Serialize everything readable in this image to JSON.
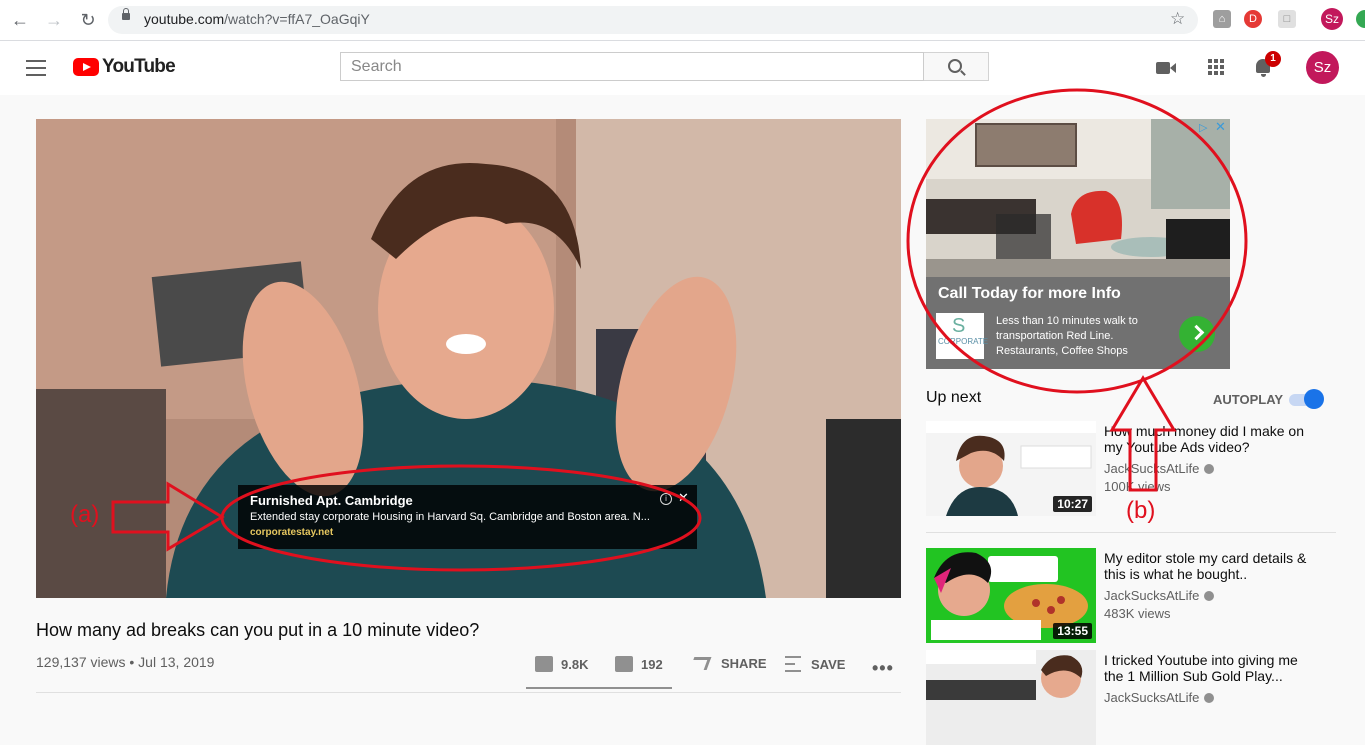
{
  "browser": {
    "url_host": "youtube.com",
    "url_path": "/watch?v=ffA7_OaGqiY",
    "profile_initials": "Sz"
  },
  "header": {
    "logo_text": "YouTube",
    "search_placeholder": "Search",
    "notification_count": "1",
    "avatar_initials": "Sz"
  },
  "video": {
    "title": "How many ad breaks can you put in a 10 minute video?",
    "meta": "129,137 views • Jul 13, 2019",
    "likes": "9.8K",
    "dislikes": "192",
    "share_label": "SHARE",
    "save_label": "SAVE",
    "more_label": "•••"
  },
  "overlay_ad": {
    "title": "Furnished Apt. Cambridge",
    "description": "Extended stay corporate Housing in Harvard Sq. Cambridge and Boston area. N...",
    "url": "corporatestay.net",
    "info": "i",
    "close": "✕"
  },
  "display_ad": {
    "headline": "Call Today for more Info",
    "body": "Less than 10 minutes walk to transportation Red Line. Restaurants, Coffee Shops",
    "logo_letter": "S",
    "logo_text": "CORPORATE",
    "adchoices": "▷",
    "close": "✕"
  },
  "annotations": {
    "label_a": "(a)",
    "label_b": "(b)",
    "color": "#e0101e"
  },
  "sidebar": {
    "up_next_label": "Up next",
    "autoplay_label": "AUTOPLAY",
    "autoplay_on": true,
    "items": [
      {
        "title": "How much money did I make on my Youtube Ads video?",
        "channel": "JackSucksAtLife",
        "views": "100K views",
        "duration": "10:27"
      },
      {
        "title": "My editor stole my card details & this is what he bought..",
        "channel": "JackSucksAtLife",
        "views": "483K views",
        "duration": "13:55"
      },
      {
        "title": "I tricked Youtube into giving me the 1 Million Sub Gold Play...",
        "channel": "JackSucksAtLife",
        "views": "",
        "duration": ""
      }
    ]
  },
  "colors": {
    "brand_red": "#ff0000",
    "autoplay_blue": "#1a73e8",
    "ad_button_green": "#34b233"
  }
}
